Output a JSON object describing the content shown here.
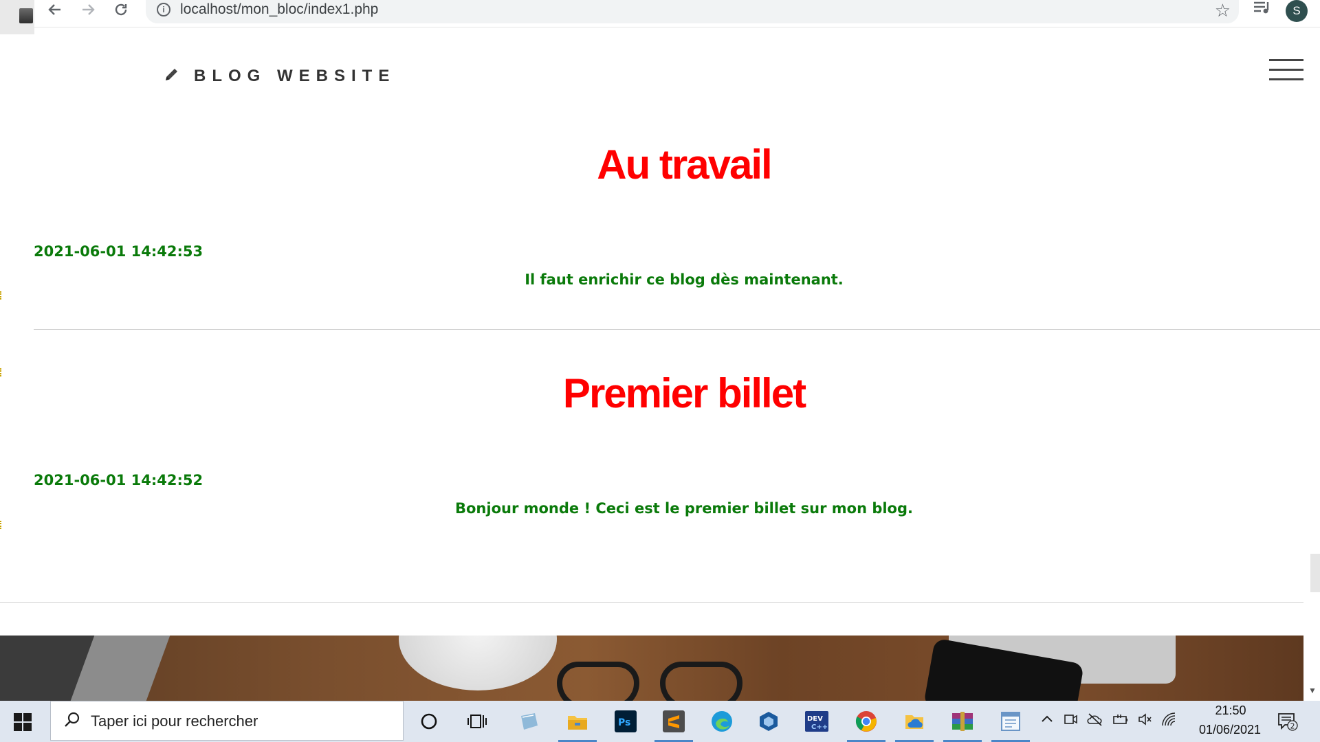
{
  "browser": {
    "url": "localhost/mon_bloc/index1.php",
    "profile_initial": "S",
    "icons": [
      "back-icon",
      "forward-icon",
      "reload-icon",
      "info-icon",
      "star-icon",
      "media-control-icon"
    ]
  },
  "site": {
    "logo_text": "BLOG WEBSITE",
    "logo_icon": "pencil-icon",
    "menu_icon": "hamburger-menu-icon"
  },
  "posts": [
    {
      "title": "Au travail",
      "date": "2021-06-01 14:42:53",
      "body": "Il faut enrichir ce blog dès maintenant."
    },
    {
      "title": "Premier billet",
      "date": "2021-06-01 14:42:52",
      "body": "Bonjour monde ! Ceci est le premier billet sur mon blog."
    }
  ],
  "colors": {
    "title": "#ff0000",
    "text_green": "#0a7a0a",
    "taskbar": "#dfe6f0"
  },
  "taskbar": {
    "search_placeholder": "Taper ici pour rechercher",
    "clock_time": "21:50",
    "clock_date": "01/06/2021",
    "notification_count": "2",
    "app_icons": [
      "cortana-icon",
      "task-view-icon",
      "notepad-icon",
      "file-explorer-icon",
      "photoshop-icon",
      "sublime-text-icon",
      "edge-icon",
      "virtualbox-icon",
      "devcpp-icon",
      "chrome-icon",
      "onedrive-icon",
      "winrar-icon",
      "writer-icon"
    ]
  }
}
